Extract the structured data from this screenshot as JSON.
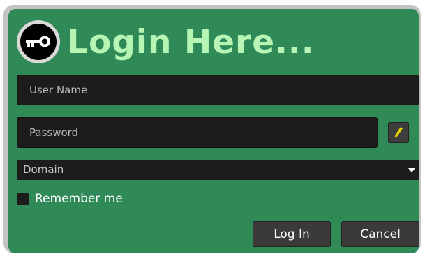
{
  "header": {
    "title": "Login Here...",
    "icon": "key-icon"
  },
  "form": {
    "username_placeholder": "User Name",
    "username_value": "",
    "password_placeholder": "Password",
    "password_value": "",
    "edit_icon": "pencil-icon",
    "domain_value": "Domain",
    "domain_arrow_icon": "chevron-down-icon",
    "remember_label": "Remember me",
    "remember_checked": false
  },
  "buttons": {
    "login_label": "Log In",
    "cancel_label": "Cancel"
  },
  "colors": {
    "panel_bg": "#2f8a58",
    "title": "#b6f5b3",
    "field_bg": "#1c1c1c",
    "button_bg": "#3a3a3a",
    "pencil": "#e8d200"
  }
}
